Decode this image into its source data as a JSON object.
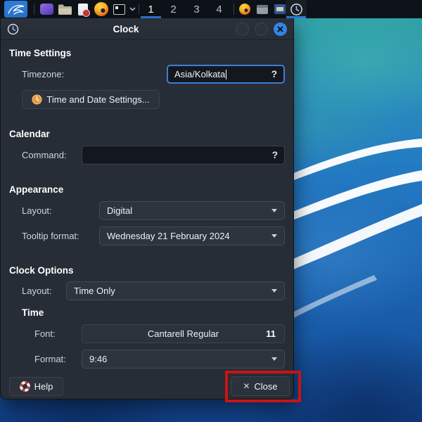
{
  "panel": {
    "workspaces": [
      "1",
      "2",
      "3",
      "4"
    ],
    "active_workspace": "1"
  },
  "window": {
    "title": "Clock"
  },
  "time_settings": {
    "header": "Time Settings",
    "timezone_label": "Timezone:",
    "timezone_value": "Asia/Kolkata",
    "help_glyph": "?",
    "time_date_button": "Time and Date Settings..."
  },
  "calendar": {
    "header": "Calendar",
    "command_label": "Command:",
    "command_value": "",
    "help_glyph": "?"
  },
  "appearance": {
    "header": "Appearance",
    "layout_label": "Layout:",
    "layout_value": "Digital",
    "tooltip_label": "Tooltip format:",
    "tooltip_value": "Wednesday 21 February 2024"
  },
  "clock_options": {
    "header": "Clock Options",
    "layout_label": "Layout:",
    "layout_value": "Time Only",
    "time_header": "Time",
    "font_label": "Font:",
    "font_name": "Cantarell Regular",
    "font_size": "11",
    "format_label": "Format:",
    "format_value": "9:46"
  },
  "footer": {
    "help_label": "Help",
    "close_label": "Close",
    "close_icon": "✕"
  },
  "colors": {
    "accent": "#3584e4",
    "annotation": "#c81414",
    "panel_bg": "#0d1319",
    "dialog_bg": "#262d36"
  }
}
